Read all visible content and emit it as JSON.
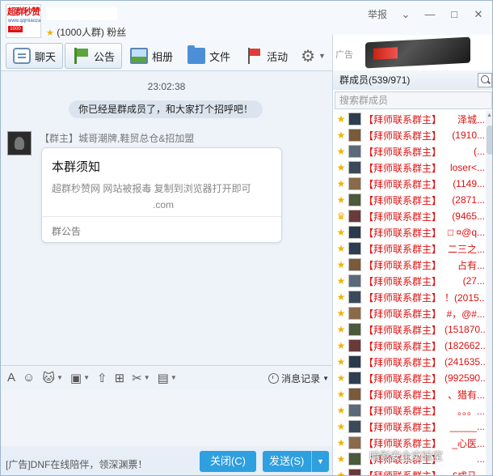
{
  "header": {
    "logo_text": "超群秒赞",
    "logo_url": "www.qqmiaozan",
    "logo_badge": "1000",
    "group_info": "(1000人群) 粉丝",
    "report_label": "举报",
    "minimize": "—",
    "maximize": "□",
    "close": "✕"
  },
  "tabs": [
    {
      "label": "聊天"
    },
    {
      "label": "公告"
    },
    {
      "label": "相册"
    },
    {
      "label": "文件"
    },
    {
      "label": "活动"
    }
  ],
  "chat": {
    "time": "23:02:38",
    "system_msg": "你已经是群成员了，和大家打个招呼吧！",
    "sender": "【群主】城哥潮牌,鞋贸总仓&招加盟",
    "card_title": "本群须知",
    "card_body_1": "超群秒赞网 网站被报毒 复制到浏览器打开即可",
    "card_body_2": ".com",
    "card_footer": "群公告"
  },
  "toolbar": {
    "history_label": "消息记录"
  },
  "bottom": {
    "ad_text": "[广告]DNF在线陪伴，领深渊票！",
    "close_label": "关闭(C)",
    "send_label": "发送(S)"
  },
  "ad": {
    "tag": "广告"
  },
  "members": {
    "header": "群成员(539/971)",
    "search_placeholder": "搜索群成员",
    "list": [
      {
        "tag": "【拜师联系群主】",
        "nick": "泽城..."
      },
      {
        "tag": "【拜师联系群主】",
        "nick": "(1910..."
      },
      {
        "tag": "【拜师联系群主】",
        "nick": "(..."
      },
      {
        "tag": "【拜师联系群主】",
        "nick": "loser<..."
      },
      {
        "tag": "【拜师联系群主】",
        "nick": "(1149..."
      },
      {
        "tag": "【拜师联系群主】",
        "nick": "(2871..."
      },
      {
        "tag": "【拜师联系群主】",
        "nick": "(9465..."
      },
      {
        "tag": "【拜师联系群主】",
        "nick": "□ ¤@q..."
      },
      {
        "tag": "【拜师联系群主】",
        "nick": "二三之..."
      },
      {
        "tag": "【拜师联系群主】",
        "nick": "占有..."
      },
      {
        "tag": "【拜师联系群主】",
        "nick": "(27..."
      },
      {
        "tag": "【拜师联系群主】",
        "nick": "！(2015..."
      },
      {
        "tag": "【拜师联系群主】",
        "nick": "#，@#..."
      },
      {
        "tag": "【拜师联系群主】",
        "nick": "(151870..."
      },
      {
        "tag": "【拜师联系群主】",
        "nick": "(182662..."
      },
      {
        "tag": "【拜师联系群主】",
        "nick": "(241635..."
      },
      {
        "tag": "【拜师联系群主】",
        "nick": "(992590..."
      },
      {
        "tag": "【拜师联系群主】",
        "nick": "、猎有..."
      },
      {
        "tag": "【拜师联系群主】",
        "nick": "。。。..."
      },
      {
        "tag": "【拜师联系群主】",
        "nick": "_____..."
      },
      {
        "tag": "【拜师联系群主】",
        "nick": "_心医..."
      },
      {
        "tag": "【拜师联系群主】",
        "nick": "..."
      },
      {
        "tag": "【拜师联系群主】",
        "nick": "£成马..."
      }
    ]
  },
  "watermark": "暗影安全实验室"
}
